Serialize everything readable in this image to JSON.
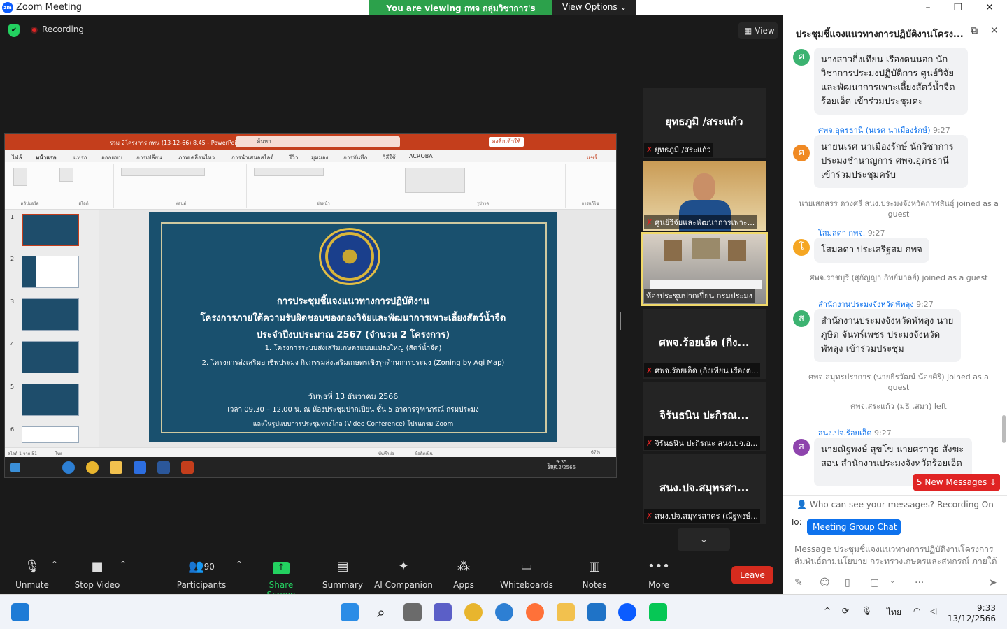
{
  "window": {
    "title": "Zoom Meeting",
    "logo": "zm",
    "minimize": "–",
    "maximize": "❐",
    "close": "✕"
  },
  "banner": {
    "message": "You are viewing กพจ กลุ่มวิชาการ's screen",
    "options": "View Options"
  },
  "stage": {
    "recording": "Recording",
    "view": "View"
  },
  "ppt": {
    "filename": "รวม 2โครงการ กพน (13-12-66) 8.45  -  PowerPoint",
    "search": "ค้นหา",
    "signin": "ลงชื่อเข้าใช้",
    "tabs": [
      "ไฟล์",
      "หน้าแรก",
      "แทรก",
      "ออกแบบ",
      "การเปลี่ยน",
      "ภาพเคลื่อนไหว",
      "การนำเสนอสไลด์",
      "รีวิว",
      "มุมมอง",
      "การบันทึก",
      "วิธีใช้",
      "ACROBAT"
    ],
    "share": "แชร์",
    "ribbon_groups": [
      "คลิปบอร์ด",
      "สไลด์",
      "ฟอนต์",
      "ย่อหน้า",
      "รูปวาด",
      "การแก้ไข"
    ],
    "thumb_numbers": [
      "1",
      "2",
      "3",
      "4",
      "5",
      "6"
    ],
    "slide": {
      "line1": "การประชุมชี้แจงแนวทางการปฏิบัติงาน",
      "line2": "โครงการภายใต้ความรับผิดชอบของกองวิจัยและพัฒนาการเพาะเลี้ยงสัตว์น้ำจืด",
      "line3": "ประจำปีงบประมาณ 2567 (จำนวน 2 โครงการ)",
      "item1": "1.  โครงการระบบส่งเสริมเกษตรแบบแปลงใหญ่ (สัตว์น้ำจืด)",
      "item2": "2.  โครงการส่งเสริมอาชีพประมง กิจกรรมส่งเสริมเกษตรเชิงรุกด้านการประมง (Zoning by Agi Map)",
      "date": "วันพุธที่ 13 ธันวาคม 2566",
      "time": "เวลา 09.30 – 12.00 น. ณ ห้องประชุมปากเปี่ยน ชั้น 5 อาคารจุฑาภรณ์ กรมประมง",
      "conf": "และในรูปแบบการประชุมทางไกล (Video Conference) โปรแกรม Zoom",
      "seal_text": "กรมประมง"
    },
    "status_left": "สไลด์ 1 จาก 51",
    "status_lang": "ไทย",
    "status_notes": "บันทึกย่อ",
    "status_display": "ข้อคิดเห็น",
    "zoom": "67%",
    "task_time": "9:35",
    "task_date": "13/12/2566",
    "task_lang": "ไทย"
  },
  "tiles": [
    {
      "big": "ยุทธภูมิ /สระแก้ว",
      "caption": "ยุทธภูมิ /สระแก้ว"
    },
    {
      "big": "",
      "caption": "ศูนย์วิจัยและพัฒนาการเพาะ..."
    },
    {
      "big": "",
      "caption": "ห้องประชุมปากเปี่ยน กรมประมง"
    },
    {
      "big": "ศพจ.ร้อยเอ็ด (กิ่ง...",
      "caption": "ศพจ.ร้อยเอ็ด (กิ่งเทียน เรืองต..."
    },
    {
      "big": "จิรันธนิน ปะกิรณ...",
      "caption": "จิรันธนิน ปะกิรณะ สนง.ปจ.อ..."
    },
    {
      "big": "สนง.ปจ.สมุทรสา...",
      "caption": "สนง.ปจ.สมุทรสาคร (ณัฐพงษ์..."
    }
  ],
  "toolbar": {
    "unmute": "Unmute",
    "stop_video": "Stop Video",
    "participants": "Participants",
    "participants_count": "90",
    "share": "Share Screen",
    "summary": "Summary",
    "ai": "AI Companion",
    "apps": "Apps",
    "whiteboards": "Whiteboards",
    "notes": "Notes",
    "more": "More",
    "leave": "Leave"
  },
  "chat": {
    "title": "ประชุมชี้แจงแนวทางการปฏิบัติงานโครง...",
    "messages": [
      {
        "avatar": "ศ",
        "text": "นางสาวกิ่งเทียน เรืองตนนอก นักวิชาการประมงปฏิบัติการ ศูนย์วิจัยและพัฒนาการเพาะเลี้ยงสัตว์น้ำจืดร้อยเอ็ด เข้าร่วมประชุมค่ะ"
      },
      {
        "sender": "ศพจ.อุดรธานี (นเรศ นาเมืองรักษ์)",
        "time": "9:27",
        "avatar": "ศ",
        "text": "นายนเรศ นาเมืองรักษ์ นักวิชาการประมงชำนาญการ ศพจ.อุดรธานี เข้าร่วมประชุมครับ"
      },
      {
        "system": "นายเสกสรร ดวงศรี สนง.ประมงจังหวัดกาฬสินธุ์ joined as a guest"
      },
      {
        "sender": "โสมลดา กพจ.",
        "time": "9:27",
        "avatar": "โ",
        "text": "โสมลดา ประเสริฐสม กพจ"
      },
      {
        "system": "ศพจ.ราชบุรี (สุกัญญา กิพย์มาลย์) joined as a guest"
      },
      {
        "sender": "สำนักงานประมงจังหวัดพัทลุง",
        "time": "9:27",
        "avatar": "ส",
        "text": "สำนักงานประมงจังหวัดพัทลุง นายภูษิต จันทร์เพชร ประมงจังหวัดพัทลุง เข้าร่วมประชุม"
      },
      {
        "system": "ศพจ.สมุทรปราการ (นายธีรวัฒน์ น้อยศิริ) joined as a guest"
      },
      {
        "system": "ศพจ.สระแก้ว (มธิ เสมา) left"
      },
      {
        "sender": "สนง.ปจ.ร้อยเอ็ด",
        "time": "9:27",
        "avatar": "ส",
        "text": "นายณัฐพงษ์ สุขโข นายศราวุธ สังฆะสอน สำนักงานประมงจังหวัดร้อยเอ็ด"
      }
    ],
    "new_messages": "5 New Messages",
    "who_can_see": "Who can see your messages? Recording On",
    "to_label": "To:",
    "recipient": "Meeting Group Chat",
    "input_placeholder": "Message ประชุมชี้แจงแนวทางการปฏิบัติงานโครงการสัมพันธ์ตามนโยบาย กระทรวงเกษตรและสหกรณ์ ภายใต้ความ..."
  },
  "taskbar": {
    "lang": "ไทย",
    "time": "9:33",
    "date": "13/12/2566"
  },
  "colors": {
    "zoom_blue": "#0e72ed",
    "share_green": "#23d160",
    "leave_red": "#d52b1e",
    "ppt_red": "#c43e1c",
    "slide_bg": "#19506e"
  }
}
